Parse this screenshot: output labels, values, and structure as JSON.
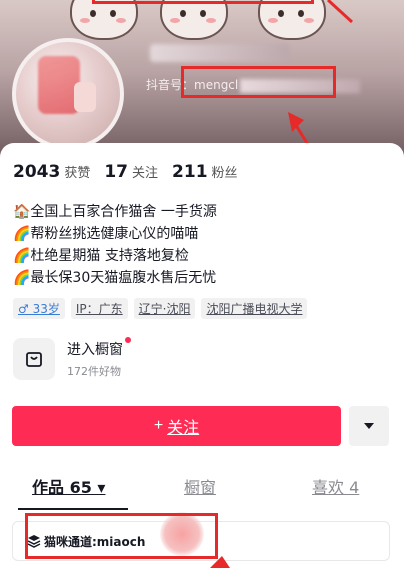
{
  "profile": {
    "douyin_id_label": "抖音号：",
    "douyin_id_visible": "mengcl"
  },
  "stats": [
    {
      "value": "2043",
      "label": "获赞"
    },
    {
      "value": "17",
      "label": "关注"
    },
    {
      "value": "211",
      "label": "粉丝"
    }
  ],
  "bio": [
    "🏠全国上百家合作猫舍 一手货源",
    "🌈帮粉丝挑选健康心仪的喵喵",
    "🌈杜绝星期猫 支持落地复检",
    "🌈最长保30天猫瘟腹水售后无忧"
  ],
  "tags": [
    {
      "text": "♂ 33岁",
      "name": "tag-age"
    },
    {
      "text": "IP：广东",
      "name": "tag-ip"
    },
    {
      "text": "辽宁·沈阳",
      "name": "tag-location"
    },
    {
      "text": "沈阳广播电视大学",
      "name": "tag-school"
    }
  ],
  "shop": {
    "title": "进入橱窗",
    "subtitle": "172件好物"
  },
  "follow_button": {
    "plus": "+",
    "label": "关注"
  },
  "tabs": [
    {
      "label": "作品 65 ▾",
      "active": true
    },
    {
      "label": "橱窗",
      "active": false
    },
    {
      "label": "喜欢 4",
      "active": false
    }
  ],
  "channel": {
    "text": "猫咪通道:miaoch"
  },
  "colors": {
    "accent": "#fe2c55",
    "annotation": "#e62a2a"
  },
  "icons": {
    "shop": "shop-bag-icon",
    "more": "caret-down-icon",
    "channel": "layers-icon"
  }
}
